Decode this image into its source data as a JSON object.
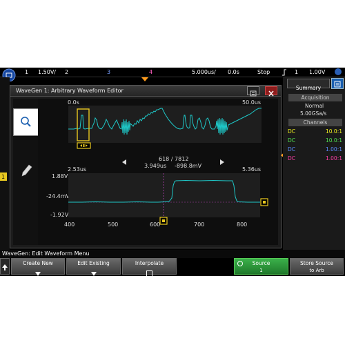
{
  "topbar": {
    "ch1_num": "1",
    "ch1_scale": "1.50V/",
    "ch2_num": "2",
    "ch3_num": "3",
    "ch4_num": "4",
    "timebase": "5.000us/",
    "delay": "0.0s",
    "run_state": "Stop",
    "trig_src": "1",
    "trig_level": "1.00V"
  },
  "dialog": {
    "title": "WaveGen 1: Arbitrary Waveform Editor"
  },
  "overview": {
    "start_time": "0.0s",
    "end_time": "50.0us"
  },
  "readout": {
    "point": "618 / 7812",
    "time": "3.949us",
    "voltage": "-898.8mV"
  },
  "detail": {
    "start_time": "2.53us",
    "end_time": "5.36us",
    "y_top": "1.88V",
    "y_mid": "-24.4mV",
    "y_bottom": "-1.92V",
    "x_ticks": [
      "400",
      "500",
      "600",
      "700",
      "800"
    ]
  },
  "summary": {
    "tab_label": "Summary",
    "acquisition_header": "Acquisition",
    "acq_mode": "Normal",
    "sample_rate": "5.00GSa/s",
    "channels_header": "Channels",
    "channels": [
      {
        "coupling": "DC",
        "value": "10.0:1",
        "color": "#f0f020"
      },
      {
        "coupling": "DC",
        "value": "10.0:1",
        "color": "#50e050"
      },
      {
        "coupling": "DC",
        "value": "1.00:1",
        "color": "#5b8cff"
      },
      {
        "coupling": "DC",
        "value": "1.00:1",
        "color": "#ff3fa8"
      }
    ]
  },
  "menu": {
    "title": "WaveGen: Edit Waveform Menu"
  },
  "softkeys": {
    "create_new": "Create New",
    "edit_existing": "Edit Existing",
    "interpolate": "Interpolate",
    "source": "Source",
    "source_value": "1",
    "store_source": "Store Source",
    "store_target": "to Arb"
  },
  "colors": {
    "trace": "#1ec8c8",
    "cursor": "#e8c820",
    "marker_orange": "#ff9a1a",
    "source_green": "#2d9a3a"
  }
}
